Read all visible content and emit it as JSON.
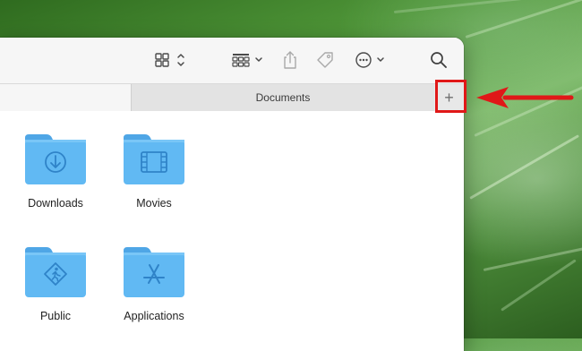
{
  "toolbar": {
    "view_icon": "icon-grid-icon",
    "group_icon": "group-icon",
    "share_icon": "share-icon",
    "tag_icon": "tag-icon",
    "more_icon": "ellipsis-icon",
    "search_icon": "search-icon"
  },
  "tabs": {
    "documents_label": "Documents",
    "new_tab_label": "+"
  },
  "folders": [
    {
      "label": "Downloads",
      "icon": "download-arrow-icon"
    },
    {
      "label": "Movies",
      "icon": "film-icon"
    },
    {
      "label": "Public",
      "icon": "public-person-icon"
    },
    {
      "label": "Applications",
      "icon": "applications-a-icon"
    }
  ],
  "colors": {
    "folder_body": "#61b9f3",
    "folder_tab": "#4fa6e6",
    "folder_emblem": "#2f83c8",
    "annotation": "#e01818"
  }
}
